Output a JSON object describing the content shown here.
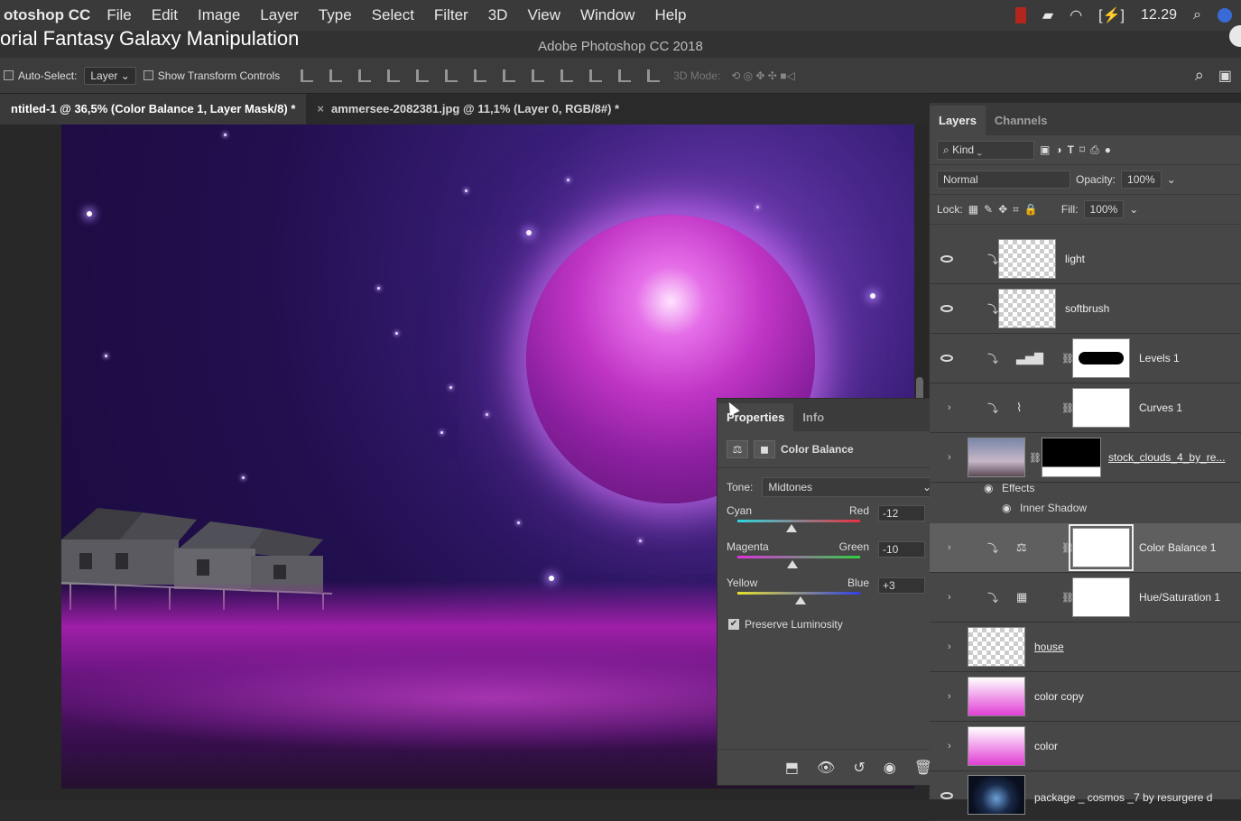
{
  "menubar": {
    "app": "otoshop CC",
    "items": [
      "File",
      "Edit",
      "Image",
      "Layer",
      "Type",
      "Select",
      "Filter",
      "3D",
      "View",
      "Window",
      "Help"
    ],
    "time": "12.29"
  },
  "video_title": "orial Fantasy Galaxy Manipulation",
  "window_title": "Adobe Photoshop CC 2018",
  "options": {
    "auto_select": "Auto-Select:",
    "auto_select_value": "Layer",
    "show_transform": "Show Transform Controls",
    "mode_3d": "3D Mode:"
  },
  "tabs": [
    {
      "label": "ntitled-1 @ 36,5% (Color Balance 1, Layer Mask/8) *"
    },
    {
      "label": "ammersee-2082381.jpg @ 11,1% (Layer 0, RGB/8#) *"
    }
  ],
  "properties": {
    "tabs": [
      "Properties",
      "Info"
    ],
    "title": "Color Balance",
    "tone_label": "Tone:",
    "tone_value": "Midtones",
    "sliders": [
      {
        "left": "Cyan",
        "right": "Red",
        "value": "-12",
        "level": -12
      },
      {
        "left": "Magenta",
        "right": "Green",
        "value": "-10",
        "level": -10
      },
      {
        "left": "Yellow",
        "right": "Blue",
        "value": "+3",
        "level": 3
      }
    ],
    "preserve": "Preserve Luminosity",
    "preserve_checked": true
  },
  "layers_panel": {
    "tabs": [
      "Layers",
      "Channels"
    ],
    "kind": "Kind",
    "blend": "Normal",
    "opacity_label": "Opacity:",
    "opacity": "100%",
    "lock_label": "Lock:",
    "fill_label": "Fill:",
    "fill": "100%",
    "layers": [
      {
        "name": "light"
      },
      {
        "name": "softbrush"
      },
      {
        "name": "Levels 1"
      },
      {
        "name": "Curves 1"
      },
      {
        "name": "stock_clouds_4_by_re..."
      },
      {
        "name": "Color Balance 1"
      },
      {
        "name": "Hue/Saturation 1"
      },
      {
        "name": "house"
      },
      {
        "name": "color copy"
      },
      {
        "name": "color"
      },
      {
        "name": "package _ cosmos _7 by resurgere d"
      }
    ],
    "effects": "Effects",
    "inner_shadow": "Inner Shadow"
  },
  "colors": {
    "panel_bg": "#474747",
    "planet": "#c135c6",
    "cloud_magenta": "#9e1fa8"
  }
}
